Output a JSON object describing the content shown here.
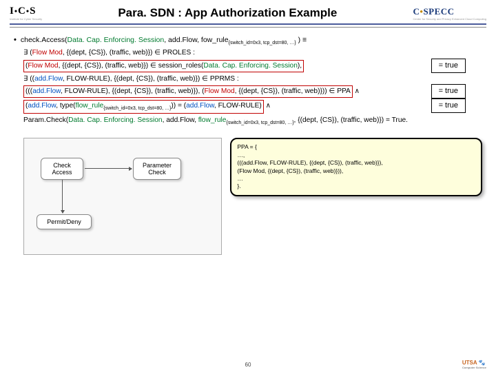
{
  "header": {
    "logo_left_main": "I",
    "logo_left_c": "C",
    "logo_left_s": "S",
    "logo_left_sub": "Institute for Cyber Security",
    "logo_right_c": "C",
    "logo_right_specc": "SPECC",
    "logo_right_sub": "Center for Security and Privacy Enhanced Cloud Computing",
    "title": "Para. SDN : App Authorization Example"
  },
  "lines": {
    "l1_pre": "check.Access(",
    "l1_arg1": "Data. Cap. Enforcing. Session",
    "l1_arg2": ", add.Flow, fow_rule",
    "l1_sub": "{switch_id=0x3, tcp_dst=80, …}",
    "l1_end": " ) ≡",
    "l2_pre": "∃ (",
    "l2_fm": "Flow Mod",
    "l2_rest": ", {(dept, {CS}), (traffic, web)}) ∈ PROLES :",
    "l3_pre": "(",
    "l3_fm": "Flow Mod",
    "l3_mid": ", {(dept, {CS}), (traffic, web)}) ∈ session_roles(",
    "l3_arg": "Data. Cap. Enforcing. Session",
    "l3_end": "),",
    "l4_pre": "∃ ((",
    "l4_af": "add.Flow",
    "l4_rest": ", FLOW-RULE), {(dept, {CS}), (traffic, web)}) ∈ PPRMS :",
    "l5_pre": "(((",
    "l5_af": "add.Flow",
    "l5_mid": ", FLOW-RULE), {(dept, {CS}), (traffic, web)}), (",
    "l5_fm": "Flow Mod",
    "l5_end": ", {(dept, {CS}), (traffic, web)})) ∈ PPA",
    "l5_and": "   ∧",
    "l6_pre": "(",
    "l6_af": "add.Flow",
    "l6_mid": ", type(",
    "l6_fr": "flow_rule",
    "l6_sub": "{switch_id=0x3, tcp_dst=80, …}",
    "l6_mid2": ")) = (",
    "l6_af2": "add.Flow",
    "l6_end": ", FLOW-RULE)",
    "l6_and": "   ∧",
    "l7_pre": "Param.Check(",
    "l7_arg1": "Data. Cap. Enforcing. Session",
    "l7_mid": ", add.Flow, ",
    "l7_fr": "flow_rule",
    "l7_sub": "{switch_id=0x3, tcp_dst=80, …}",
    "l7_mid2": ", {(dept, {CS}), (traffic, web)}) = True."
  },
  "true_label": "= true",
  "diagram": {
    "n1": "Check\nAccess",
    "n2": "Parameter\nCheck",
    "n3": "Permit/Deny"
  },
  "ppa": {
    "l0": "PPA = {",
    "l1": "…,",
    "l2": "(((add.Flow, FLOW-RULE), {(dept, {CS}), (traffic, web)}),",
    "l3": "(Flow Mod, {(dept, {CS}), (traffic, web)})),",
    "l4": "…",
    "l5": "}."
  },
  "page_num": "60",
  "footer_logo": "UTSA",
  "footer_logo_sub": "Computer Science"
}
